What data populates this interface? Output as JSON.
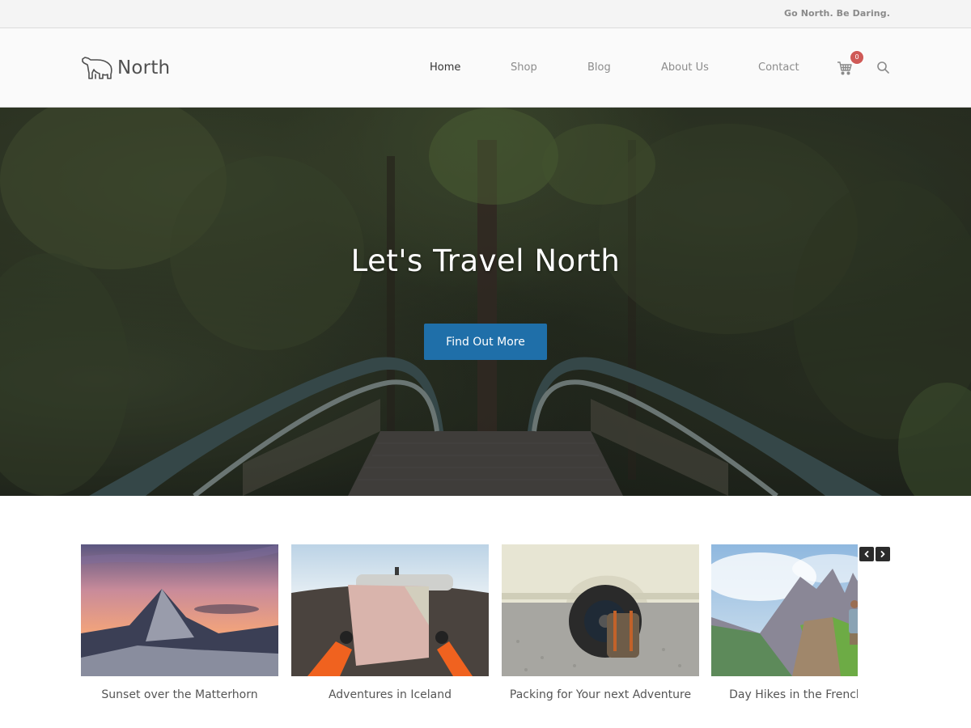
{
  "topbar": {
    "tagline": "Go North. Be Daring."
  },
  "header": {
    "logo_text": "North",
    "logo_icon": "polar-bear-icon",
    "nav": [
      {
        "label": "Home",
        "active": true
      },
      {
        "label": "Shop",
        "active": false
      },
      {
        "label": "Blog",
        "active": false
      },
      {
        "label": "About Us",
        "active": false
      },
      {
        "label": "Contact",
        "active": false
      }
    ],
    "cart_icon": "shopping-cart-icon",
    "cart_count": "0",
    "search_icon": "search-icon"
  },
  "hero": {
    "title": "Let's Travel North",
    "button_label": "Find Out More",
    "button_color": "#1f6fa9"
  },
  "carousel": {
    "prev_icon": "chevron-left-icon",
    "next_icon": "chevron-right-icon",
    "slides": [
      {
        "caption": "Sunset over the Matterhorn"
      },
      {
        "caption": "Adventures in Iceland"
      },
      {
        "caption": "Packing for Your next Adventure"
      },
      {
        "caption": "Day Hikes in the French Alps"
      }
    ]
  },
  "colors": {
    "accent": "#1f6fa9",
    "badge": "#cf5a57",
    "nav_active": "#333333",
    "nav_inactive": "#8c8c8c"
  }
}
